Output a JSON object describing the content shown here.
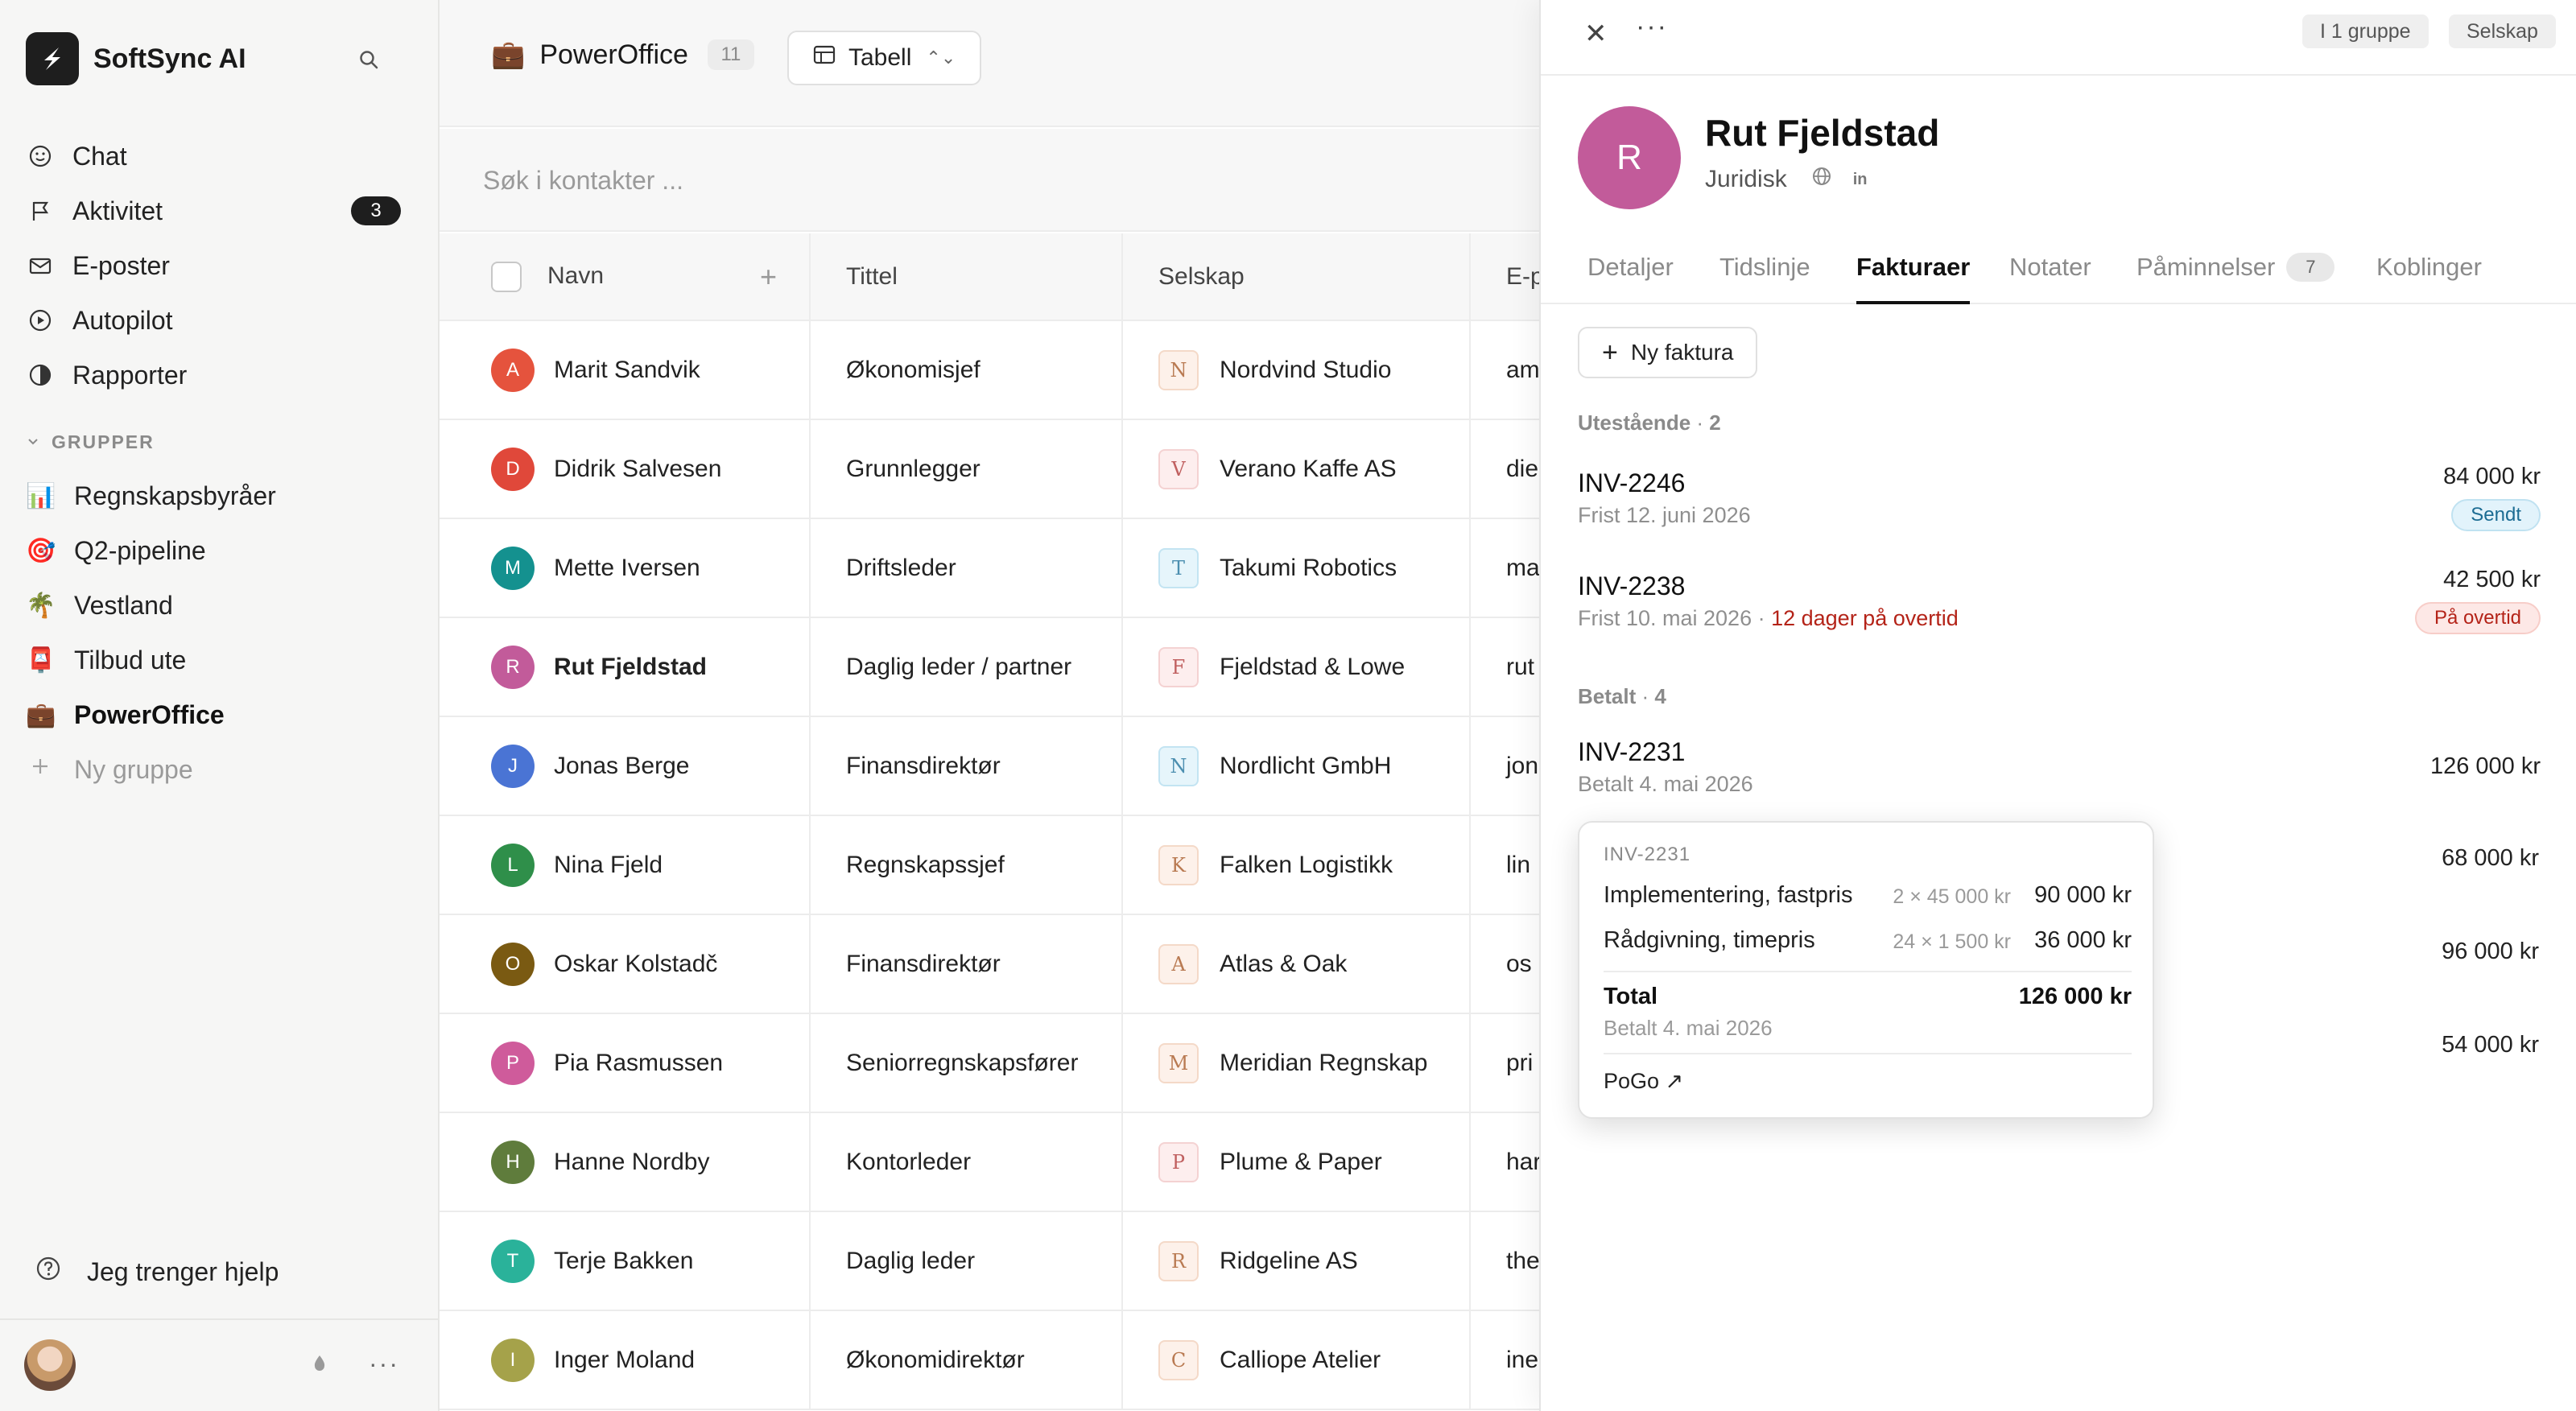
{
  "brand": {
    "name": "SoftSync AI"
  },
  "nav": [
    {
      "label": "Chat",
      "icon": "smile-icon"
    },
    {
      "label": "Aktivitet",
      "icon": "flag-icon",
      "badge": "3"
    },
    {
      "label": "E-poster",
      "icon": "mail-icon"
    },
    {
      "label": "Autopilot",
      "icon": "play-circle-icon"
    },
    {
      "label": "Rapporter",
      "icon": "pie-icon"
    }
  ],
  "groups": {
    "heading": "GRUPPER",
    "items": [
      {
        "emoji": "📊",
        "label": "Regnskapsbyråer"
      },
      {
        "emoji": "🎯",
        "label": "Q2-pipeline"
      },
      {
        "emoji": "🌴",
        "label": "Vestland"
      },
      {
        "emoji": "📮",
        "label": "Tilbud ute"
      },
      {
        "emoji": "💼",
        "label": "PowerOffice"
      }
    ],
    "new_label": "Ny gruppe"
  },
  "help": {
    "label": "Jeg trenger hjelp"
  },
  "main": {
    "title_emoji": "💼",
    "title": "PowerOffice",
    "count": "11",
    "view_label": "Tabell",
    "search_placeholder": "Søk i kontakter ...",
    "columns": {
      "name": "Navn",
      "title": "Tittel",
      "company": "Selskap",
      "email": "E-post"
    },
    "rows": [
      {
        "initial": "A",
        "color": "#e5533d",
        "name": "Marit Sandvik",
        "title": "Økonomisjef",
        "logo": "N",
        "logo_style": "warm",
        "company": "Nordvind Studio",
        "email": "am"
      },
      {
        "initial": "D",
        "color": "#e0483a",
        "name": "Didrik Salvesen",
        "title": "Grunnlegger",
        "logo": "V",
        "logo_style": "pink",
        "company": "Verano Kaffe AS",
        "email": "die"
      },
      {
        "initial": "M",
        "color": "#14918f",
        "name": "Mette Iversen",
        "title": "Driftsleder",
        "logo": "T",
        "logo_style": "cool",
        "company": "Takumi Robotics",
        "email": "ma"
      },
      {
        "initial": "R",
        "color": "#c25b9a",
        "name": "Rut Fjeldstad",
        "title": "Daglig leder / partner",
        "logo": "F",
        "logo_style": "pink",
        "company": "Fjeldstad & Lowe",
        "email": "rut"
      },
      {
        "initial": "J",
        "color": "#4a74d4",
        "name": "Jonas Berge",
        "title": "Finansdirektør",
        "logo": "N",
        "logo_style": "cool",
        "company": "Nordlicht GmbH",
        "email": "jon"
      },
      {
        "initial": "L",
        "color": "#2f8f4a",
        "name": "Nina Fjeld",
        "title": "Regnskapssjef",
        "logo": "K",
        "logo_style": "warm",
        "company": "Falken Logistikk",
        "email": "lin"
      },
      {
        "initial": "O",
        "color": "#7a5a12",
        "name": "Oskar Kolstadč",
        "title": "Finansdirektør",
        "logo": "A",
        "logo_style": "warm",
        "company": "Atlas & Oak",
        "email": "os"
      },
      {
        "initial": "P",
        "color": "#cf5b9b",
        "name": "Pia Rasmussen",
        "title": "Seniorregnskapsfører",
        "logo": "M",
        "logo_style": "warm",
        "company": "Meridian Regnskap",
        "email": "pri"
      },
      {
        "initial": "H",
        "color": "#5f7c3c",
        "name": "Hanne Nordby",
        "title": "Kontorleder",
        "logo": "P",
        "logo_style": "pink",
        "company": "Plume & Paper",
        "email": "har"
      },
      {
        "initial": "T",
        "color": "#2ab29a",
        "name": "Terje Bakken",
        "title": "Daglig leder",
        "logo": "R",
        "logo_style": "warm",
        "company": "Ridgeline AS",
        "email": "the"
      },
      {
        "initial": "I",
        "color": "#a5a24a",
        "name": "Inger Moland",
        "title": "Økonomidirektør",
        "logo": "C",
        "logo_style": "warm",
        "company": "Calliope Atelier",
        "email": "ine"
      }
    ]
  },
  "panel": {
    "chip_group": "I 1 gruppe",
    "chip_company": "Selskap",
    "initial": "R",
    "name": "Rut Fjeldstad",
    "department": "Juridisk",
    "linkedin": "in",
    "tabs": [
      {
        "label": "Detaljer"
      },
      {
        "label": "Tidslinje"
      },
      {
        "label": "Fakturaer",
        "active": true
      },
      {
        "label": "Notater"
      },
      {
        "label": "Påminnelser",
        "count": "7"
      },
      {
        "label": "Koblinger"
      }
    ],
    "new_invoice": "Ny faktura",
    "outstanding": {
      "label": "Utestående",
      "count": "2"
    },
    "inv_outstanding": [
      {
        "id": "INV-2246",
        "due": "Frist 12. juni 2026",
        "amount": "84 000 kr",
        "status": "Sendt"
      },
      {
        "id": "INV-2238",
        "due": "Frist 10. mai 2026",
        "overdue": "12 dager på overtid",
        "amount": "42 500 kr",
        "status": "På overtid"
      }
    ],
    "paid": {
      "label": "Betalt",
      "count": "4"
    },
    "inv_paid_first": {
      "id": "INV-2231",
      "date": "Betalt 4. mai 2026",
      "amount": "126 000 kr"
    },
    "paid_amounts": [
      "68 000 kr",
      "96 000 kr",
      "54 000 kr"
    ],
    "popover": {
      "id": "INV-2231",
      "lines": [
        {
          "desc": "Implementering, fastpris",
          "qty": "2 × 45 000 kr",
          "value": "90 000 kr"
        },
        {
          "desc": "Rådgivning, timepris",
          "qty": "24 × 1 500 kr",
          "value": "36 000 kr"
        }
      ],
      "total_label": "Total",
      "total_value": "126 000 kr",
      "paid_date": "Betalt 4. mai 2026",
      "link": "PoGo ↗"
    }
  }
}
